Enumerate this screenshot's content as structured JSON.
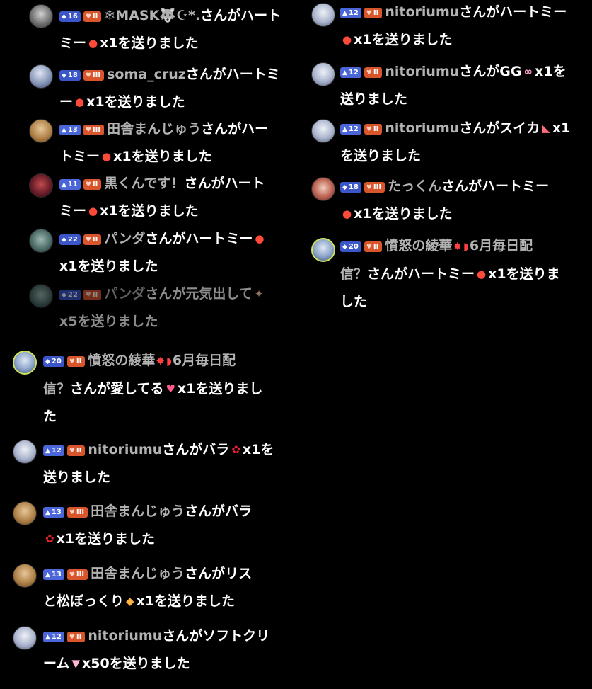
{
  "badges": {
    "diamond_icon": "◆",
    "triangle_icon": "▲",
    "heart_icon": "♥"
  },
  "gifts": {
    "apple_icon": "●",
    "rose_icon": "✿",
    "watermelon_icon": "◣",
    "gg_icon": "∞",
    "pinecone_icon": "◆",
    "cream_icon": "▼",
    "love_icon": "♥",
    "energy_icon": "✦"
  },
  "colors": {
    "background": "#000000",
    "username": "#b3b3b3",
    "text": "#ffffff",
    "level_badge": "#3a56c8",
    "fan_badge": "#d9552c"
  },
  "panels": {
    "top_left": [
      {
        "level": "16",
        "fan": "II",
        "name": "❄MASK🐺☪*.",
        "l1_tail": "さんがハート",
        "l2_head": "ミー",
        "l2_tail": "x1を送りました"
      },
      {
        "level": "18",
        "fan": "III",
        "name": "soma_cruz",
        "l1_tail": "さんがハートミ",
        "l2_head": "ー",
        "l2_tail": "x1を送りました"
      },
      {
        "level": "13",
        "fan": "III",
        "name": "田舎まんじゅう",
        "l1_tail": "さんがハー",
        "l2_head": "トミー",
        "l2_tail": "x1を送りました"
      },
      {
        "level": "11",
        "fan": "II",
        "name": "黒くんです！",
        "l1_tail": "さんがハート",
        "l2_head": "ミー",
        "l2_tail": "x1を送りました"
      },
      {
        "level": "22",
        "fan": "II",
        "name": "パンダ",
        "l1_tail": "さんがハートミー",
        "l2_tail": "x1を送りました"
      },
      {
        "level": "22",
        "fan": "II",
        "name": "パンダ",
        "l1_tail": "さんが元気出して",
        "l2_tail": "x5を送りました"
      }
    ],
    "top_right": [
      {
        "level": "12",
        "fan": "II",
        "name": "nitoriumu",
        "l1_tail": "さんがハートミー",
        "l2_tail": "x1を送りました"
      },
      {
        "level": "12",
        "fan": "II",
        "name": "nitoriumu",
        "l1_tail": "さんがGG",
        "l1_after": "x1を",
        "l2_tail": "送りました"
      },
      {
        "level": "12",
        "fan": "II",
        "name": "nitoriumu",
        "l1_tail": "さんがスイカ",
        "l1_after": "x1",
        "l2_tail": "を送りました"
      },
      {
        "level": "18",
        "fan": "III",
        "name": "たっくん",
        "l1_tail": "さんがハートミー",
        "l2_tail": "x1を送りました"
      },
      {
        "level": "20",
        "fan": "II",
        "name": "憤怒の綾華",
        "l1_tail": "6月毎日配",
        "l2_head": "信？",
        "l2_tail": "さんがハートミー",
        "l2_after": "x1を送りま",
        "l3": "した"
      }
    ],
    "bottom": [
      {
        "level": "20",
        "fan": "II",
        "name": "憤怒の綾華",
        "l1_tail": "6月毎日配",
        "l2_head": "信？",
        "l2_tail": "さんが愛してる",
        "l2_after": "x1を送りまし",
        "l3": "た"
      },
      {
        "level": "12",
        "fan": "II",
        "name": "nitoriumu",
        "l1_tail": "さんがバラ",
        "l1_after": "x1を",
        "l2_tail": "送りました"
      },
      {
        "level": "13",
        "fan": "III",
        "name": "田舎まんじゅう",
        "l1_tail": "さんがバラ",
        "l2_tail": "x1を送りました"
      },
      {
        "level": "13",
        "fan": "III",
        "name": "田舎まんじゅう",
        "l1_tail": "さんがリス",
        "l2_head": "と松ぼっくり",
        "l2_tail": "x1を送りました"
      },
      {
        "level": "12",
        "fan": "II",
        "name": "nitoriumu",
        "l1_tail": "さんがソフトクリ",
        "l2_head": "ーム",
        "l2_tail": "x50を送りました"
      }
    ]
  }
}
